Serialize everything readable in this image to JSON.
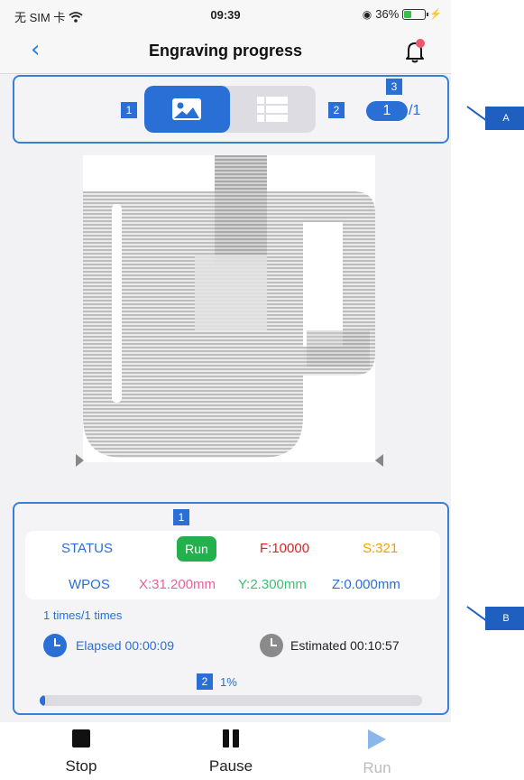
{
  "status_bar": {
    "carrier": "无 SIM 卡",
    "time": "09:39",
    "battery_text": "36%",
    "battery_level": 0.36
  },
  "nav": {
    "title": "Engraving progress",
    "bell_badge_color": "#f0566a"
  },
  "panel_a": {
    "markers": [
      "1",
      "2",
      "3"
    ],
    "page_current": "1",
    "page_total": "/1",
    "callout": "A"
  },
  "panel_b": {
    "marker_top": "1",
    "marker_progress": "2",
    "callout": "B",
    "status_label": "STATUS",
    "run_badge": "Run",
    "feed": "F:10000",
    "spindle": "S:321",
    "wpos_label": "WPOS",
    "x": "X:31.200mm",
    "y": "Y:2.300mm",
    "z": "Z:0.000mm",
    "times": "1 times/1 times",
    "elapsed": "Elapsed 00:00:09",
    "estimated": "Estimated 00:10:57",
    "percent": "1%",
    "progress": 0.01
  },
  "toolbar": {
    "stop": "Stop",
    "pause": "Pause",
    "run": "Run"
  },
  "colors": {
    "accent": "#2a6fd6",
    "run_green": "#22b14c",
    "feed_red": "#e02020",
    "spindle_orange": "#f2a000",
    "x_pink": "#e8609a",
    "y_green": "#3ac070",
    "z_blue": "#2a6fd6"
  }
}
